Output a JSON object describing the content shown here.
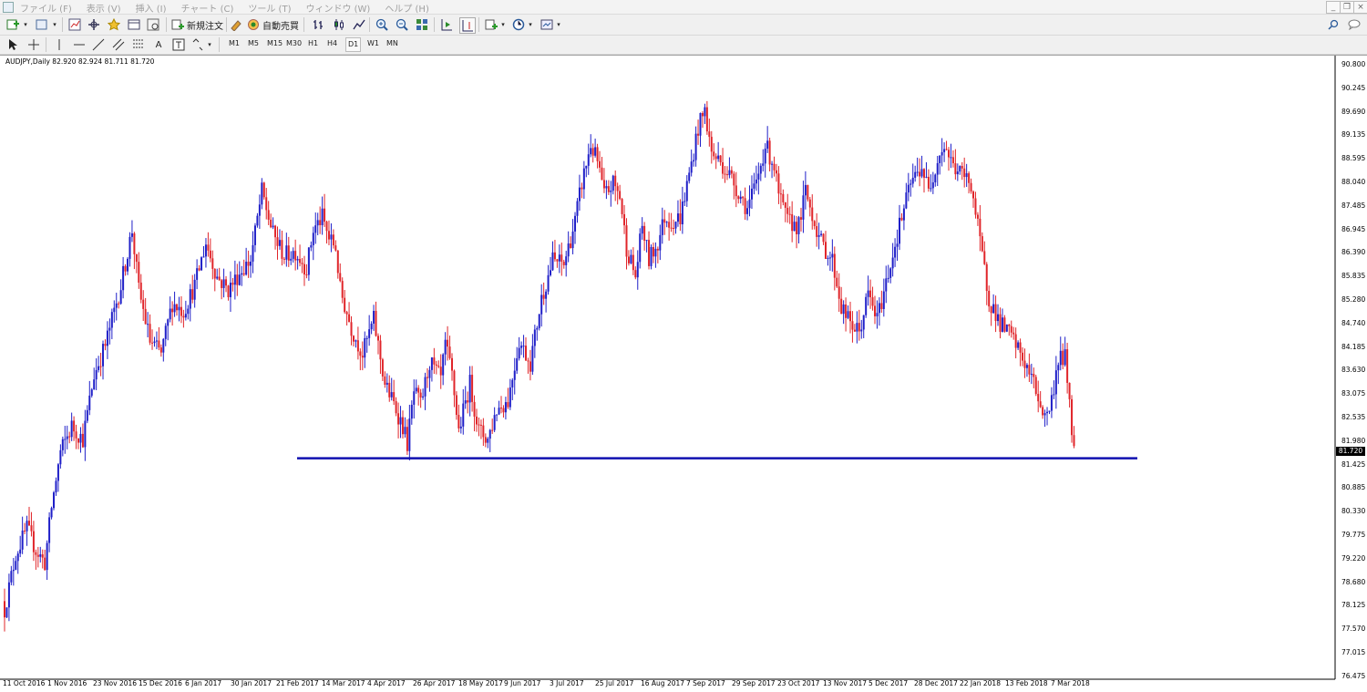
{
  "menu": {
    "items": [
      "ファイル (F)",
      "表示 (V)",
      "挿入 (I)",
      "チャート (C)",
      "ツール (T)",
      "ウィンドウ (W)",
      "ヘルプ (H)"
    ]
  },
  "toolbar": {
    "new_order_label": "新規注文",
    "auto_trading_label": "自動売買",
    "timeframes": [
      "M1",
      "M5",
      "M15",
      "M30",
      "H1",
      "H4",
      "D1",
      "W1",
      "MN"
    ],
    "active_timeframe": "D1"
  },
  "chart": {
    "header": "AUDJPY,Daily  82.920 82.924 81.711 81.720",
    "current_price": "81.720",
    "price_axis": [
      "90.800",
      "90.245",
      "89.690",
      "89.135",
      "88.595",
      "88.040",
      "87.485",
      "86.945",
      "86.390",
      "85.835",
      "85.280",
      "84.740",
      "84.185",
      "83.630",
      "83.075",
      "82.535",
      "81.980",
      "81.425",
      "80.885",
      "80.330",
      "79.775",
      "79.220",
      "78.680",
      "78.125",
      "77.570",
      "77.015",
      "76.475"
    ],
    "date_axis": [
      "11 Oct 2016",
      "1 Nov 2016",
      "23 Nov 2016",
      "15 Dec 2016",
      "6 Jan 2017",
      "30 Jan 2017",
      "21 Feb 2017",
      "14 Mar 2017",
      "4 Apr 2017",
      "26 Apr 2017",
      "18 May 2017",
      "9 Jun 2017",
      "3 Jul 2017",
      "25 Jul 2017",
      "16 Aug 2017",
      "7 Sep 2017",
      "29 Sep 2017",
      "23 Oct 2017",
      "13 Nov 2017",
      "5 Dec 2017",
      "28 Dec 2017",
      "22 Jan 2018",
      "13 Feb 2018",
      "7 Mar 2018"
    ],
    "support_line_price": 81.55,
    "colors": {
      "bull": "#1f1fc8",
      "bear": "#e0252a",
      "support": "#1010b0"
    }
  },
  "chart_data": {
    "type": "candlestick",
    "symbol": "AUDJPY",
    "timeframe": "Daily",
    "ylim": [
      76.475,
      90.8
    ],
    "keypoints": [
      [
        0,
        78.0
      ],
      [
        5,
        79.3
      ],
      [
        10,
        79.9
      ],
      [
        14,
        79.4
      ],
      [
        18,
        79.1
      ],
      [
        21,
        80.4
      ],
      [
        25,
        81.7
      ],
      [
        30,
        82.3
      ],
      [
        35,
        82.0
      ],
      [
        40,
        83.5
      ],
      [
        45,
        84.2
      ],
      [
        52,
        85.6
      ],
      [
        57,
        86.9
      ],
      [
        60,
        85.5
      ],
      [
        65,
        84.3
      ],
      [
        70,
        84.0
      ],
      [
        75,
        85.2
      ],
      [
        80,
        85.0
      ],
      [
        85,
        85.6
      ],
      [
        90,
        86.6
      ],
      [
        95,
        85.8
      ],
      [
        100,
        85.5
      ],
      [
        105,
        85.9
      ],
      [
        110,
        86.2
      ],
      [
        115,
        87.8
      ],
      [
        120,
        86.8
      ],
      [
        125,
        86.3
      ],
      [
        130,
        86.4
      ],
      [
        135,
        86.0
      ],
      [
        138,
        86.9
      ],
      [
        142,
        87.2
      ],
      [
        145,
        86.7
      ],
      [
        148,
        86.5
      ],
      [
        150,
        85.5
      ],
      [
        155,
        84.6
      ],
      [
        160,
        84.0
      ],
      [
        165,
        84.8
      ],
      [
        170,
        83.3
      ],
      [
        175,
        82.7
      ],
      [
        178,
        82.3
      ],
      [
        180,
        81.9
      ],
      [
        183,
        83.1
      ],
      [
        186,
        82.8
      ],
      [
        190,
        83.8
      ],
      [
        195,
        83.4
      ],
      [
        197,
        84.2
      ],
      [
        200,
        83.5
      ],
      [
        203,
        82.2
      ],
      [
        208,
        83.3
      ],
      [
        212,
        82.2
      ],
      [
        216,
        82.0
      ],
      [
        220,
        82.7
      ],
      [
        225,
        82.9
      ],
      [
        230,
        84.3
      ],
      [
        235,
        83.8
      ],
      [
        240,
        85.3
      ],
      [
        245,
        86.2
      ],
      [
        250,
        86.1
      ],
      [
        255,
        87.1
      ],
      [
        258,
        88.0
      ],
      [
        262,
        88.9
      ],
      [
        265,
        88.5
      ],
      [
        268,
        87.7
      ],
      [
        272,
        88.0
      ],
      [
        275,
        87.7
      ],
      [
        278,
        86.5
      ],
      [
        282,
        85.8
      ],
      [
        285,
        87.0
      ],
      [
        288,
        86.2
      ],
      [
        292,
        86.6
      ],
      [
        295,
        87.2
      ],
      [
        298,
        87.1
      ],
      [
        302,
        87.2
      ],
      [
        306,
        88.2
      ],
      [
        310,
        89.3
      ],
      [
        313,
        89.7
      ],
      [
        316,
        88.7
      ],
      [
        320,
        88.5
      ],
      [
        324,
        88.2
      ],
      [
        328,
        87.8
      ],
      [
        332,
        87.4
      ],
      [
        336,
        88.0
      ],
      [
        340,
        88.9
      ],
      [
        344,
        88.4
      ],
      [
        346,
        87.7
      ],
      [
        350,
        87.1
      ],
      [
        355,
        87.0
      ],
      [
        358,
        87.8
      ],
      [
        362,
        87.1
      ],
      [
        365,
        86.6
      ],
      [
        370,
        86.2
      ],
      [
        374,
        85.1
      ],
      [
        378,
        84.7
      ],
      [
        382,
        84.5
      ],
      [
        386,
        85.4
      ],
      [
        390,
        84.8
      ],
      [
        395,
        85.9
      ],
      [
        400,
        87.0
      ],
      [
        405,
        88.0
      ],
      [
        410,
        88.4
      ],
      [
        413,
        87.8
      ],
      [
        417,
        88.6
      ],
      [
        420,
        88.9
      ],
      [
        424,
        88.4
      ],
      [
        428,
        88.2
      ],
      [
        432,
        88.0
      ],
      [
        436,
        86.6
      ],
      [
        440,
        85.3
      ],
      [
        445,
        84.7
      ],
      [
        450,
        84.4
      ],
      [
        455,
        83.9
      ],
      [
        460,
        83.3
      ],
      [
        465,
        82.5
      ],
      [
        468,
        82.9
      ],
      [
        471,
        83.9
      ],
      [
        474,
        83.9
      ],
      [
        476,
        82.9
      ],
      [
        478,
        81.72
      ]
    ],
    "support_level": 81.55
  }
}
